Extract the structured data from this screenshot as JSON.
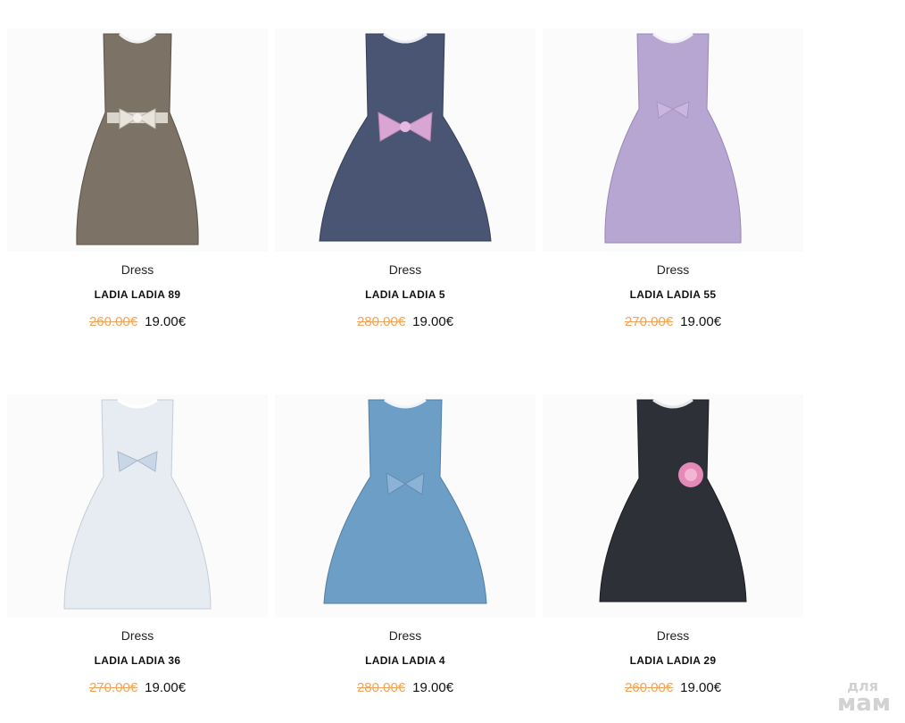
{
  "products": [
    {
      "category": "Dress",
      "name": "LADIA LADIA 89",
      "old_price": "260.00€",
      "price": "19.00€",
      "image": "dress-leopard-print-image",
      "color": "#7d7266",
      "bow": "#e8e4dc"
    },
    {
      "category": "Dress",
      "name": "LADIA LADIA 5",
      "old_price": "280.00€",
      "price": "19.00€",
      "image": "dress-navy-satin-image",
      "color": "#4a5574",
      "bow": "#d9a6d4"
    },
    {
      "category": "Dress",
      "name": "LADIA LADIA 55",
      "old_price": "270.00€",
      "price": "19.00€",
      "image": "dress-lilac-satin-image",
      "color": "#b7a6d2",
      "bow": "#c9b5de"
    },
    {
      "category": "Dress",
      "name": "LADIA LADIA 36",
      "old_price": "270.00€",
      "price": "19.00€",
      "image": "dress-white-image",
      "color": "#e7ecf2",
      "bow": "#c9d6e6"
    },
    {
      "category": "Dress",
      "name": "LADIA LADIA 4",
      "old_price": "280.00€",
      "price": "19.00€",
      "image": "dress-blue-satin-image",
      "color": "#6d9ec6",
      "bow": "#8cb3d6"
    },
    {
      "category": "Dress",
      "name": "LADIA LADIA 29",
      "old_price": "260.00€",
      "price": "19.00€",
      "image": "dress-black-lace-image",
      "color": "#2e3038",
      "bow": "#e58ab8"
    }
  ],
  "watermark": {
    "line1": "для",
    "line2": "мам"
  }
}
